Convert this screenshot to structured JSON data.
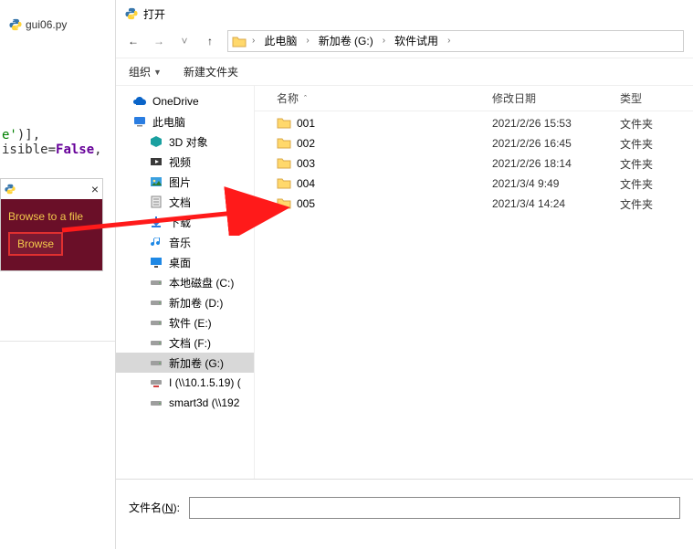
{
  "editor": {
    "tab_filename": "gui06.py",
    "code_frag1": "e'",
    "code_frag2": ")],",
    "code_frag3": "isible",
    "code_frag4": "=",
    "code_frag5": "False",
    "code_frag6": ","
  },
  "gui_app": {
    "close_glyph": "×",
    "label": "Browse to a file",
    "button": "Browse"
  },
  "dialog": {
    "title": "打开",
    "nav": {
      "back": "←",
      "forward": "→",
      "recent": "˅",
      "up": "↑"
    },
    "breadcrumbs": [
      "此电脑",
      "新加卷 (G:)",
      "软件试用"
    ],
    "crumb_sep": "›",
    "toolbar": {
      "organize": "组织",
      "new_folder": "新建文件夹"
    },
    "tree": [
      {
        "label": "OneDrive",
        "depth": 1,
        "icon": "onedrive"
      },
      {
        "label": "此电脑",
        "depth": 1,
        "icon": "pc"
      },
      {
        "label": "3D 对象",
        "depth": 2,
        "icon": "3d"
      },
      {
        "label": "视频",
        "depth": 2,
        "icon": "video"
      },
      {
        "label": "图片",
        "depth": 2,
        "icon": "pictures"
      },
      {
        "label": "文档",
        "depth": 2,
        "icon": "docs"
      },
      {
        "label": "下载",
        "depth": 2,
        "icon": "down"
      },
      {
        "label": "音乐",
        "depth": 2,
        "icon": "music"
      },
      {
        "label": "桌面",
        "depth": 2,
        "icon": "desktop"
      },
      {
        "label": "本地磁盘 (C:)",
        "depth": 2,
        "icon": "drive"
      },
      {
        "label": "新加卷 (D:)",
        "depth": 2,
        "icon": "drive"
      },
      {
        "label": "软件 (E:)",
        "depth": 2,
        "icon": "drive"
      },
      {
        "label": "文档 (F:)",
        "depth": 2,
        "icon": "drive"
      },
      {
        "label": "新加卷 (G:)",
        "depth": 2,
        "icon": "drive",
        "selected": true
      },
      {
        "label": "I (\\\\10.1.5.19) (",
        "depth": 2,
        "icon": "netdrive"
      },
      {
        "label": "smart3d (\\\\192",
        "depth": 2,
        "icon": "drive"
      }
    ],
    "columns": {
      "name": "名称",
      "date": "修改日期",
      "type": "类型",
      "sort": "ˆ"
    },
    "rows": [
      {
        "name": "001",
        "date": "2021/2/26 15:53",
        "type": "文件夹"
      },
      {
        "name": "002",
        "date": "2021/2/26 16:45",
        "type": "文件夹"
      },
      {
        "name": "003",
        "date": "2021/2/26 18:14",
        "type": "文件夹"
      },
      {
        "name": "004",
        "date": "2021/3/4 9:49",
        "type": "文件夹"
      },
      {
        "name": "005",
        "date": "2021/3/4 14:24",
        "type": "文件夹"
      }
    ],
    "footer": {
      "filename_label_pre": "文件名(",
      "filename_label_u": "N",
      "filename_label_post": "):",
      "filename_value": ""
    }
  }
}
